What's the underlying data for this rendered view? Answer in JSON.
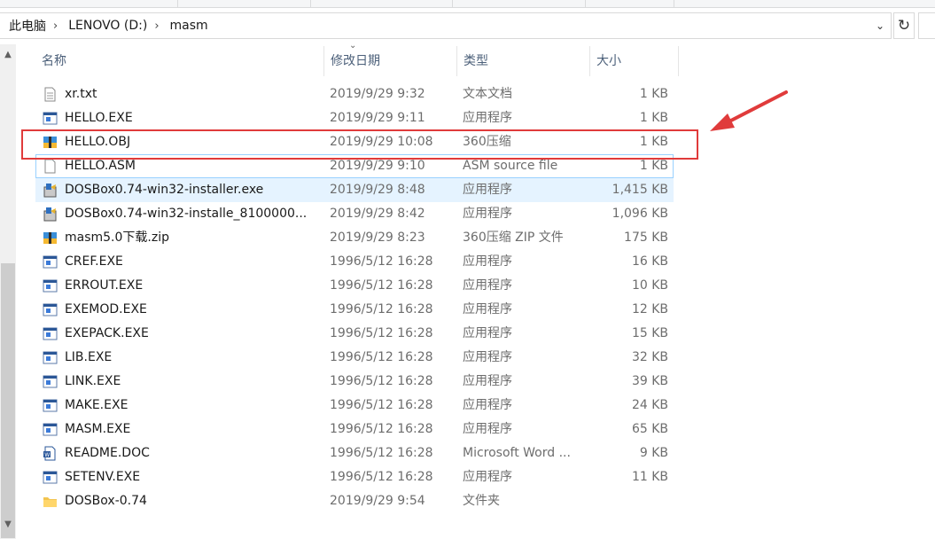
{
  "breadcrumb": {
    "items": [
      "此电脑",
      "LENOVO (D:)",
      "masm"
    ],
    "separator": "›"
  },
  "columns": {
    "name": "名称",
    "date": "修改日期",
    "type": "类型",
    "size": "大小"
  },
  "rows": [
    {
      "name": "xr.txt",
      "date": "2019/9/29 9:32",
      "type": "文本文档",
      "size": "1 KB",
      "icon": "text-file-icon"
    },
    {
      "name": "HELLO.EXE",
      "date": "2019/9/29 9:11",
      "type": "应用程序",
      "size": "1 KB",
      "icon": "application-icon"
    },
    {
      "name": "HELLO.OBJ",
      "date": "2019/9/29 10:08",
      "type": "360压缩",
      "size": "1 KB",
      "icon": "archive-icon"
    },
    {
      "name": "HELLO.ASM",
      "date": "2019/9/29 9:10",
      "type": "ASM source file",
      "size": "1 KB",
      "icon": "blank-file-icon"
    },
    {
      "name": "DOSBox0.74-win32-installer.exe",
      "date": "2019/9/29 8:48",
      "type": "应用程序",
      "size": "1,415 KB",
      "icon": "installer-icon"
    },
    {
      "name": "DOSBox0.74-win32-installe_8100000...",
      "date": "2019/9/29 8:42",
      "type": "应用程序",
      "size": "1,096 KB",
      "icon": "installer-icon"
    },
    {
      "name": "masm5.0下载.zip",
      "date": "2019/9/29 8:23",
      "type": "360压缩 ZIP 文件",
      "size": "175 KB",
      "icon": "archive-icon"
    },
    {
      "name": "CREF.EXE",
      "date": "1996/5/12 16:28",
      "type": "应用程序",
      "size": "16 KB",
      "icon": "application-icon"
    },
    {
      "name": "ERROUT.EXE",
      "date": "1996/5/12 16:28",
      "type": "应用程序",
      "size": "10 KB",
      "icon": "application-icon"
    },
    {
      "name": "EXEMOD.EXE",
      "date": "1996/5/12 16:28",
      "type": "应用程序",
      "size": "12 KB",
      "icon": "application-icon"
    },
    {
      "name": "EXEPACK.EXE",
      "date": "1996/5/12 16:28",
      "type": "应用程序",
      "size": "15 KB",
      "icon": "application-icon"
    },
    {
      "name": "LIB.EXE",
      "date": "1996/5/12 16:28",
      "type": "应用程序",
      "size": "32 KB",
      "icon": "application-icon"
    },
    {
      "name": "LINK.EXE",
      "date": "1996/5/12 16:28",
      "type": "应用程序",
      "size": "39 KB",
      "icon": "application-icon"
    },
    {
      "name": "MAKE.EXE",
      "date": "1996/5/12 16:28",
      "type": "应用程序",
      "size": "24 KB",
      "icon": "application-icon"
    },
    {
      "name": "MASM.EXE",
      "date": "1996/5/12 16:28",
      "type": "应用程序",
      "size": "65 KB",
      "icon": "application-icon"
    },
    {
      "name": "README.DOC",
      "date": "1996/5/12 16:28",
      "type": "Microsoft Word ...",
      "size": "9 KB",
      "icon": "word-document-icon"
    },
    {
      "name": "SETENV.EXE",
      "date": "1996/5/12 16:28",
      "type": "应用程序",
      "size": "11 KB",
      "icon": "application-icon"
    },
    {
      "name": "DOSBox-0.74",
      "date": "2019/9/29 9:54",
      "type": "文件夹",
      "size": "",
      "icon": "folder-icon"
    }
  ],
  "colors": {
    "selection": "#e5f3ff",
    "hover_outline": "#99d1ff",
    "annotation": "#e03b3b",
    "header_text": "#4c607a",
    "muted_text": "#6d6d6d"
  }
}
